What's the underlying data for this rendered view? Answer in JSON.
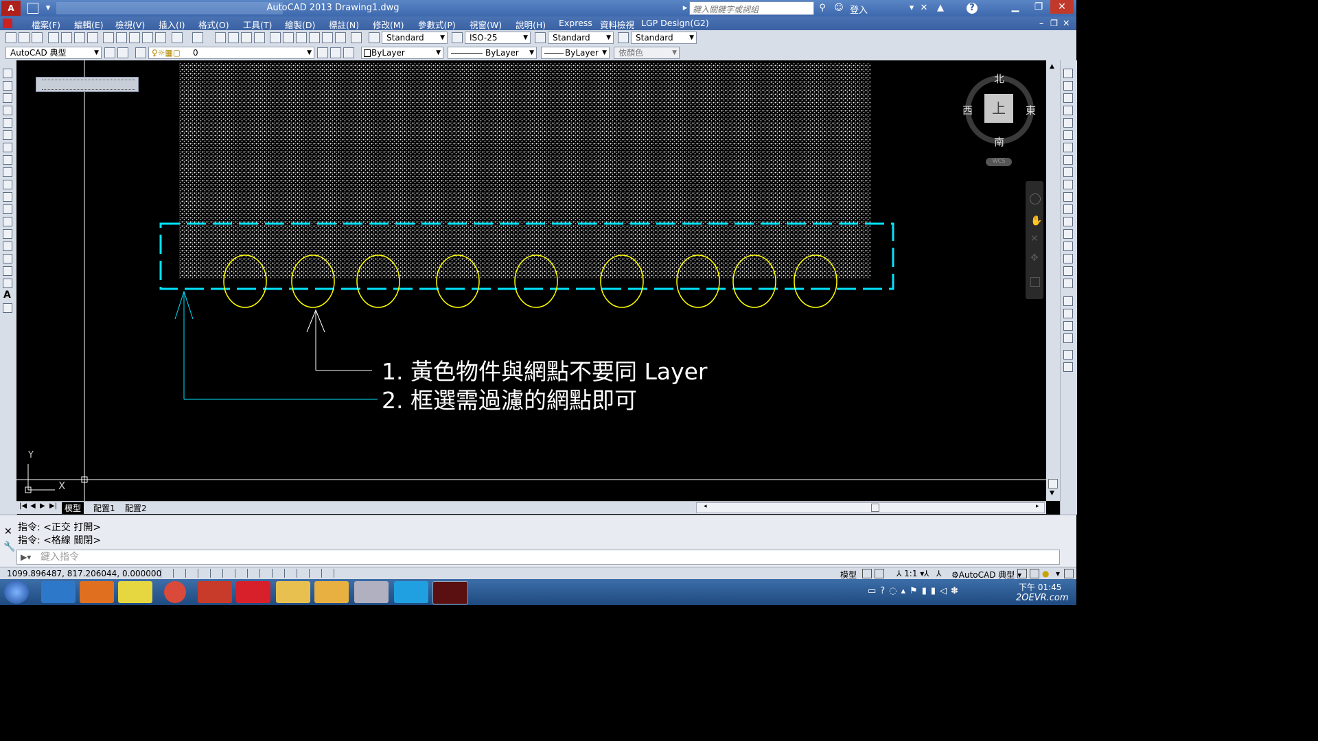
{
  "window": {
    "title": "AutoCAD 2013    Drawing1.dwg",
    "search_placeholder": "鍵入關鍵字或詞組",
    "login_label": "登入"
  },
  "menu": [
    "檔案(F)",
    "編輯(E)",
    "檢視(V)",
    "插入(I)",
    "格式(O)",
    "工具(T)",
    "繪製(D)",
    "標註(N)",
    "修改(M)",
    "參數式(P)",
    "視窗(W)",
    "說明(H)",
    "Express",
    "資料檢視",
    "LGP Design(G2)"
  ],
  "toolbar": {
    "text_style": "Standard",
    "dim_style": "ISO-25",
    "table_style": "Standard",
    "mleader_style": "Standard",
    "workspace": "AutoCAD 典型",
    "layer": "0",
    "color": "ByLayer",
    "linetype": "ByLayer",
    "lineweight": "ByLayer",
    "plotstyle": "依顏色"
  },
  "canvas": {
    "annotation_1": "1. 黃色物件與網點不要同 Layer",
    "annotation_2": "2. 框選需過濾的網點即可",
    "ucs_y": "Y",
    "ucs_x": "X",
    "colors": {
      "hatch": "#ffffff",
      "ellipse": "#ffff00",
      "selection_box": "#00e5ff",
      "leader": "#ffffff"
    }
  },
  "viewcube": {
    "north": "北",
    "south": "南",
    "east": "東",
    "west": "西",
    "face": "上",
    "wcs": "WCS"
  },
  "tabs": [
    "模型",
    "配置1",
    "配置2"
  ],
  "command": {
    "history": [
      "指令:   <正交 打開>",
      "指令:   <格線 關閉>"
    ],
    "input_placeholder": "鍵入指令"
  },
  "status": {
    "coords": "1099.896487, 817.206044, 0.000000",
    "model_label": "模型",
    "scale": "1:1",
    "workspace": "AutoCAD 典型"
  },
  "taskbar": {
    "time": "下午 01:45",
    "watermark": "2OEVR.com"
  }
}
